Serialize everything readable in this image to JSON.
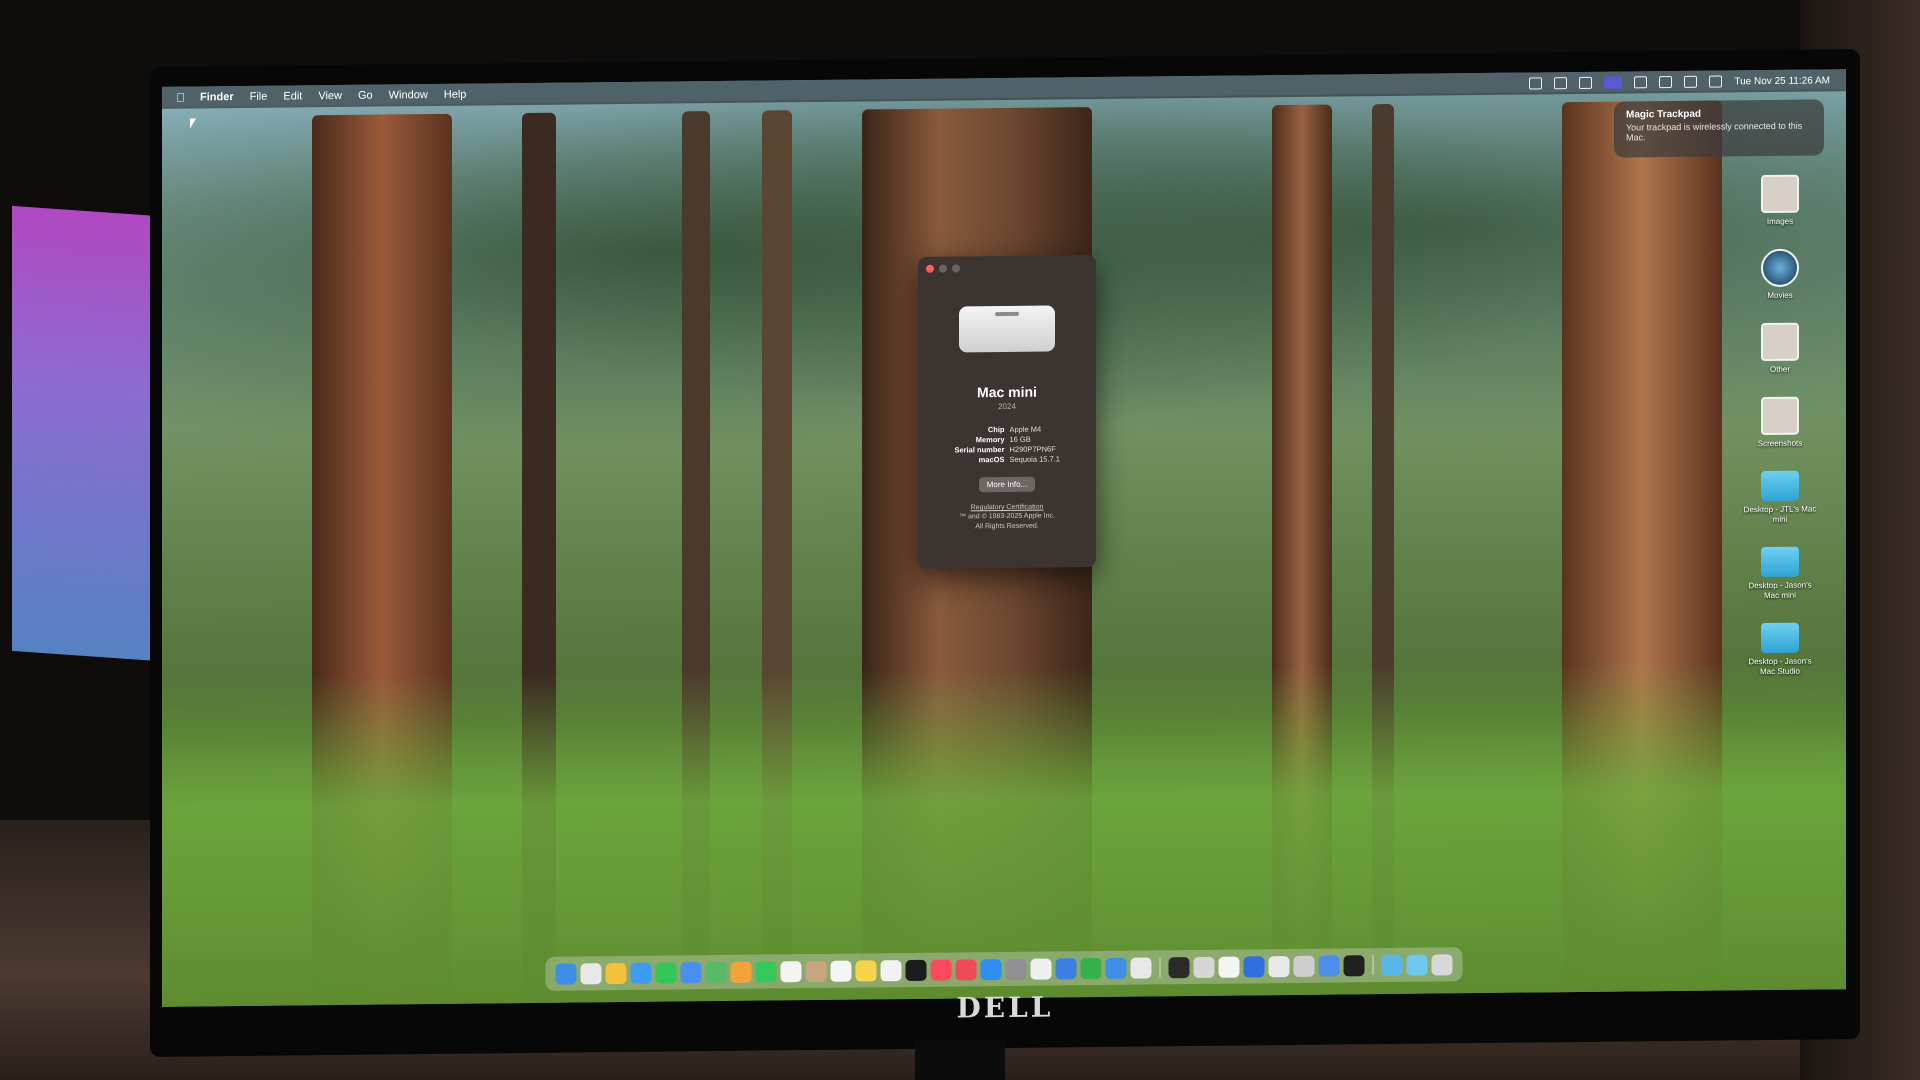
{
  "menubar": {
    "app": "Finder",
    "items": [
      "File",
      "Edit",
      "View",
      "Go",
      "Window",
      "Help"
    ],
    "clock": "Tue Nov 25  11:26 AM",
    "status_icons": [
      "control-center-icon",
      "battery-icon",
      "screen-mirroring-icon",
      "airplay-icon",
      "stage-manager-icon",
      "wifi-icon",
      "search-icon",
      "siri-icon"
    ]
  },
  "notification": {
    "title": "Magic Trackpad",
    "body": "Your trackpad is wirelessly connected to this Mac."
  },
  "desktop_items": [
    {
      "label": "Images",
      "icon": "image-stack-icon"
    },
    {
      "label": "Movies",
      "icon": "movie-icon"
    },
    {
      "label": "Other",
      "icon": "document-icon"
    },
    {
      "label": "Screenshots",
      "icon": "screenshot-stack-icon"
    },
    {
      "label": "Desktop - JTL's Mac mini",
      "icon": "folder-icon"
    },
    {
      "label": "Desktop - Jason's Mac mini",
      "icon": "folder-icon"
    },
    {
      "label": "Desktop - Jason's Mac Studio",
      "icon": "folder-icon"
    }
  ],
  "about": {
    "name": "Mac mini",
    "year": "2024",
    "specs": [
      {
        "label": "Chip",
        "value": "Apple M4"
      },
      {
        "label": "Memory",
        "value": "16 GB"
      },
      {
        "label": "Serial number",
        "value": "H290P7PN6F"
      },
      {
        "label": "macOS",
        "value": "Sequoia 15.7.1"
      }
    ],
    "more_button": "More Info...",
    "regulatory": "Regulatory Certification",
    "copyright": "™ and © 1983-2025 Apple Inc.",
    "rights": "All Rights Reserved."
  },
  "dock": {
    "apps": [
      {
        "name": "finder",
        "color": "#3b8fe6"
      },
      {
        "name": "launchpad",
        "color": "#e9e9e9"
      },
      {
        "name": "chrome",
        "color": "#f2c23b"
      },
      {
        "name": "safari",
        "color": "#3d9cf2"
      },
      {
        "name": "messages",
        "color": "#33c759"
      },
      {
        "name": "mail",
        "color": "#4a8ff0"
      },
      {
        "name": "maps",
        "color": "#5ab969"
      },
      {
        "name": "photos",
        "color": "#f3a33a"
      },
      {
        "name": "facetime",
        "color": "#34c759"
      },
      {
        "name": "calendar",
        "color": "#f4f4f4"
      },
      {
        "name": "contacts",
        "color": "#c8a57e"
      },
      {
        "name": "reminders",
        "color": "#f5f5f5"
      },
      {
        "name": "notes",
        "color": "#f7d54a"
      },
      {
        "name": "freeform",
        "color": "#f2f2f2"
      },
      {
        "name": "apple-tv",
        "color": "#1c1c1e"
      },
      {
        "name": "music",
        "color": "#fa4a5e"
      },
      {
        "name": "news",
        "color": "#f04a5a"
      },
      {
        "name": "app-store",
        "color": "#2f8ff0"
      },
      {
        "name": "system-settings",
        "color": "#8e8e93"
      },
      {
        "name": "pages",
        "color": "#f0f0f0"
      },
      {
        "name": "keynote",
        "color": "#3b7fe0"
      },
      {
        "name": "numbers",
        "color": "#35b04a"
      },
      {
        "name": "xcode",
        "color": "#3f8ee8"
      },
      {
        "name": "activity-monitor",
        "color": "#e8e8e8"
      }
    ],
    "utilities": [
      {
        "name": "terminal",
        "color": "#2a2a2a"
      },
      {
        "name": "screenshot",
        "color": "#d6d6d6"
      },
      {
        "name": "notion",
        "color": "#f4f4f4"
      },
      {
        "name": "1password",
        "color": "#2f6fe0"
      },
      {
        "name": "slack",
        "color": "#e9e9e9"
      },
      {
        "name": "keyboard-viewer",
        "color": "#cfcfcf"
      },
      {
        "name": "preview",
        "color": "#4c8ee9"
      },
      {
        "name": "stream-deck",
        "color": "#202020"
      }
    ],
    "end": [
      {
        "name": "downloads-folder",
        "color": "#57b7e8"
      },
      {
        "name": "desktop-folder",
        "color": "#6fc7ee"
      },
      {
        "name": "trash",
        "color": "#d8d8d8"
      }
    ]
  },
  "monitor": {
    "brand": "DELL"
  }
}
